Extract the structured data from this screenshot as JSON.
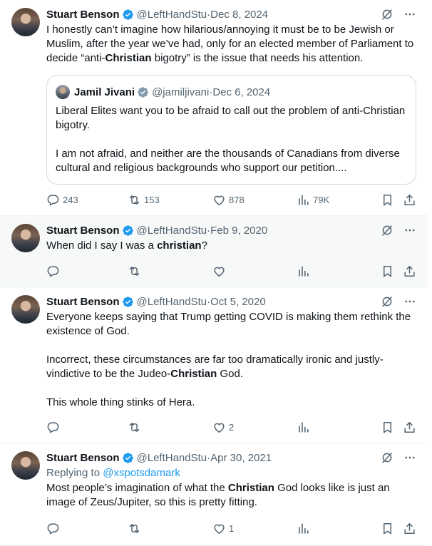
{
  "tweets": [
    {
      "name": "Stuart Benson",
      "handle": "@LeftHandStu",
      "date": "Dec 8, 2024",
      "text": [
        {
          "t": "I honestly can’t imagine how hilarious/annoying it must be to be Jewish or Muslim, after the year we’ve had, only for an elected member of Parliament to decide “anti-"
        },
        {
          "t": "Christian",
          "b": true
        },
        {
          "t": " bigotry” is the issue that needs his attention."
        }
      ],
      "quote": {
        "name": "Jamil Jivani",
        "handle": "@jamiljivani",
        "date": "Dec 6, 2024",
        "text": "Liberal Elites want you to be afraid to call out the problem of anti-Christian bigotry.\n\nI am not afraid, and neither are the thousands of Canadians from diverse cultural and religious backgrounds who support our petition...."
      },
      "stats": {
        "replies": "243",
        "reposts": "153",
        "likes": "878",
        "views": "79K"
      }
    },
    {
      "name": "Stuart Benson",
      "handle": "@LeftHandStu",
      "date": "Feb 9, 2020",
      "text": [
        {
          "t": "When did I say I was a "
        },
        {
          "t": "christian",
          "b": true
        },
        {
          "t": "?"
        }
      ],
      "stats": {
        "replies": "",
        "reposts": "",
        "likes": "",
        "views": ""
      }
    },
    {
      "name": "Stuart Benson",
      "handle": "@LeftHandStu",
      "date": "Oct 5, 2020",
      "text": [
        {
          "t": "Everyone keeps saying that Trump getting COVID is making them rethink the existence of God.\n\nIncorrect, these circumstances are far too dramatically ironic and justly-vindictive to be the Judeo-"
        },
        {
          "t": "Christian",
          "b": true
        },
        {
          "t": " God.\n\nThis whole thing stinks of Hera."
        }
      ],
      "stats": {
        "replies": "",
        "reposts": "",
        "likes": "2",
        "views": ""
      }
    },
    {
      "name": "Stuart Benson",
      "handle": "@LeftHandStu",
      "date": "Apr 30, 2021",
      "replying_label": "Replying to",
      "replying_to": "@xspotsdamark",
      "text": [
        {
          "t": "Most people’s imagination of what the "
        },
        {
          "t": "Christian",
          "b": true
        },
        {
          "t": " God looks like is just an image of Zeus/Jupiter, so this is pretty fitting."
        }
      ],
      "stats": {
        "replies": "",
        "reposts": "",
        "likes": "1",
        "views": ""
      }
    }
  ],
  "separator": "·",
  "colors": {
    "text": "#0f1419",
    "muted": "#536471",
    "link": "#1d9bf0",
    "verified": "#1d9bf0",
    "border": "#eff3f4",
    "highlight_bg": "#f7f9f9"
  },
  "icons": [
    "verified-badge-icon",
    "grok-icon",
    "more-icon",
    "reply-icon",
    "repost-icon",
    "like-icon",
    "views-icon",
    "bookmark-icon",
    "share-icon"
  ]
}
